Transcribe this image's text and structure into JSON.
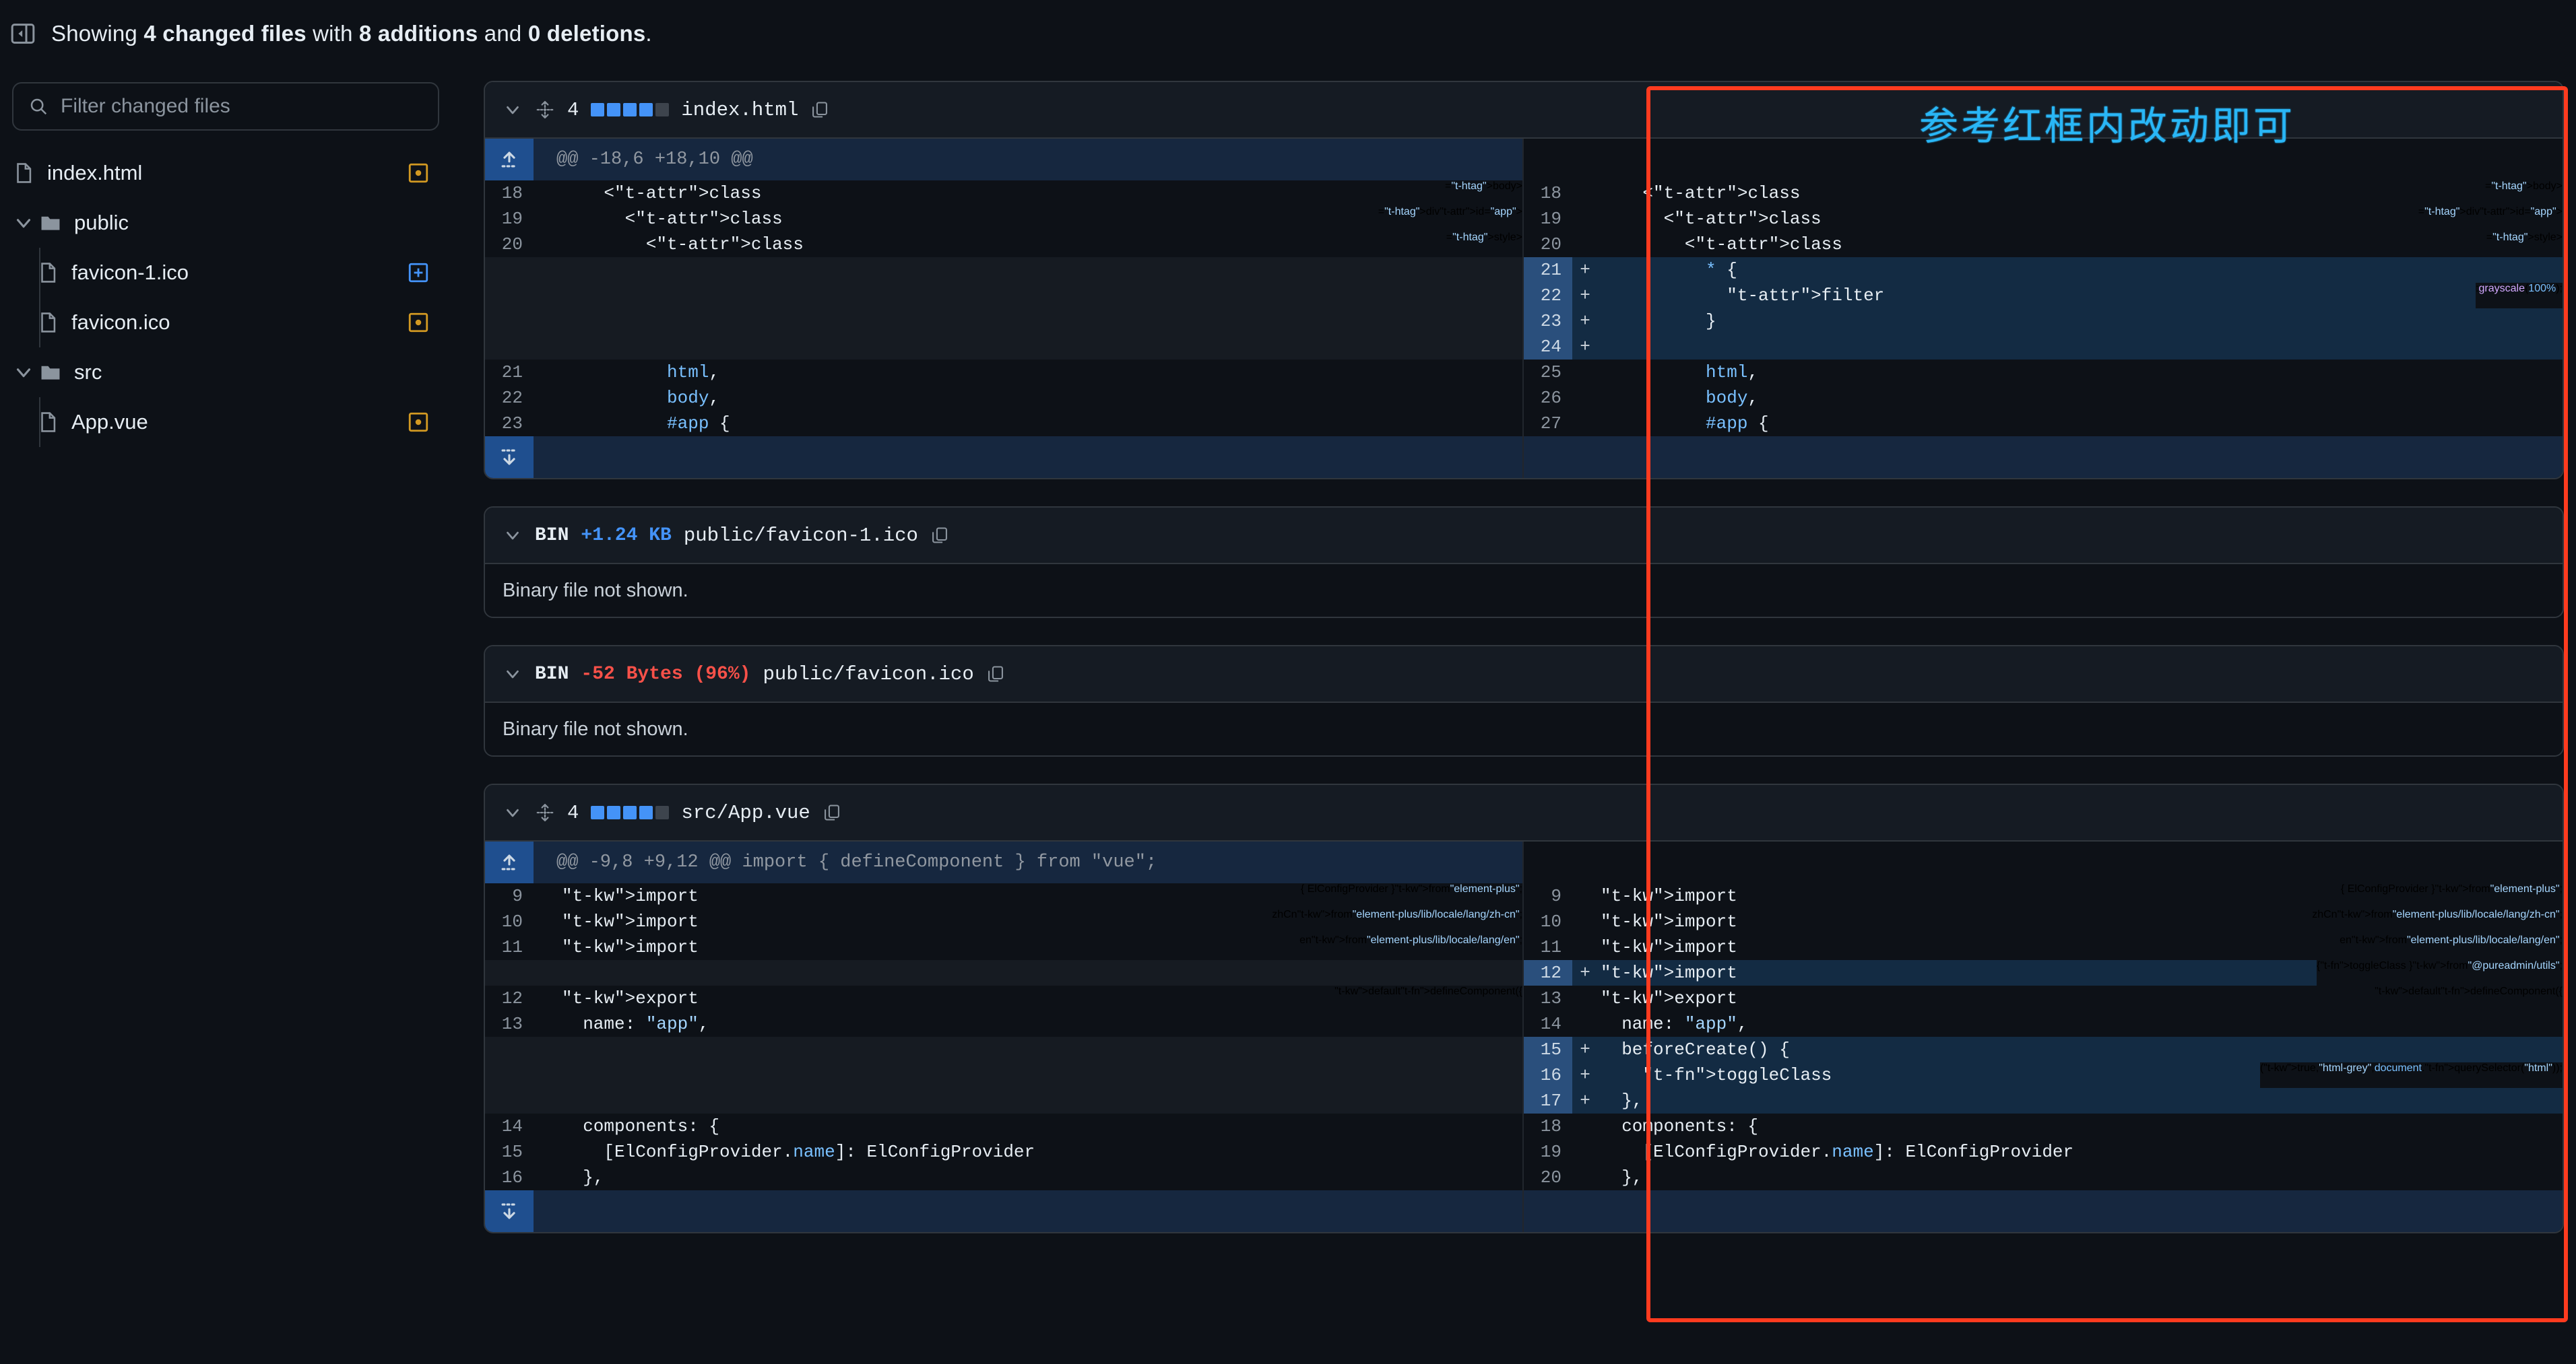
{
  "header": {
    "collapse_icon": "sidebar-collapse-icon",
    "summary_prefix": "Showing ",
    "summary_files": "4 changed files",
    "summary_mid": " with ",
    "summary_additions": "8 additions",
    "summary_and": " and ",
    "summary_deletions": "0 deletions",
    "summary_suffix": "."
  },
  "sidebar": {
    "filter_placeholder": "Filter changed files",
    "filter_value": "",
    "search_icon": "search-icon",
    "tree": [
      {
        "label": "index.html",
        "type": "file",
        "depth": 1,
        "icon": "file-icon",
        "status": "modified",
        "status_icon": "dot-square-icon"
      },
      {
        "label": "public",
        "type": "folder",
        "depth": 1,
        "icon": "folder-icon",
        "expanded": true,
        "status": ""
      },
      {
        "label": "favicon-1.ico",
        "type": "file",
        "depth": 2,
        "icon": "file-icon",
        "status": "added",
        "status_icon": "plus-square-icon"
      },
      {
        "label": "favicon.ico",
        "type": "file",
        "depth": 2,
        "icon": "file-icon",
        "status": "modified",
        "status_icon": "dot-square-icon"
      },
      {
        "label": "src",
        "type": "folder",
        "depth": 1,
        "icon": "folder-icon",
        "expanded": true,
        "status": ""
      },
      {
        "label": "App.vue",
        "type": "file",
        "depth": 2,
        "icon": "file-icon",
        "status": "modified",
        "status_icon": "dot-square-icon"
      }
    ]
  },
  "annotation": {
    "text": "参考红框内改动即可",
    "box_color": "#ff3b1f",
    "text_color": "#29b6f6"
  },
  "files": [
    {
      "kind": "text",
      "changes": "4",
      "stat_squares": [
        "add",
        "add",
        "add",
        "add",
        "neutral"
      ],
      "path": "index.html",
      "copy_icon": "copy-path-icon",
      "chevron_icon": "chevron-down-icon",
      "move_icon": "move-handle-icon",
      "hunk_header": "@@ -18,6 +18,10 @@",
      "expand_up_icon": "expand-up-icon",
      "expand_down_icon": "expand-down-icon",
      "left": [
        {
          "type": "ctx",
          "num": "18",
          "sign": "",
          "code": "    <body>"
        },
        {
          "type": "ctx",
          "num": "19",
          "sign": "",
          "code": "      <div id=\"app\">"
        },
        {
          "type": "ctx",
          "num": "20",
          "sign": "",
          "code": "        <style>"
        },
        {
          "type": "empty",
          "num": "",
          "sign": "",
          "code": ""
        },
        {
          "type": "empty",
          "num": "",
          "sign": "",
          "code": ""
        },
        {
          "type": "empty",
          "num": "",
          "sign": "",
          "code": ""
        },
        {
          "type": "empty",
          "num": "",
          "sign": "",
          "code": ""
        },
        {
          "type": "ctx",
          "num": "21",
          "sign": "",
          "code": "          html,"
        },
        {
          "type": "ctx",
          "num": "22",
          "sign": "",
          "code": "          body,"
        },
        {
          "type": "ctx",
          "num": "23",
          "sign": "",
          "code": "          #app {"
        }
      ],
      "right": [
        {
          "type": "ctx",
          "num": "18",
          "sign": "",
          "code": "    <body>"
        },
        {
          "type": "ctx",
          "num": "19",
          "sign": "",
          "code": "      <div id=\"app\">"
        },
        {
          "type": "ctx",
          "num": "20",
          "sign": "",
          "code": "        <style>"
        },
        {
          "type": "add",
          "num": "21",
          "sign": "+",
          "code": "          * {"
        },
        {
          "type": "add",
          "num": "22",
          "sign": "+",
          "code": "            filter: grayscale(100%);"
        },
        {
          "type": "add",
          "num": "23",
          "sign": "+",
          "code": "          }"
        },
        {
          "type": "add",
          "num": "24",
          "sign": "+",
          "code": ""
        },
        {
          "type": "ctx",
          "num": "25",
          "sign": "",
          "code": "          html,"
        },
        {
          "type": "ctx",
          "num": "26",
          "sign": "",
          "code": "          body,"
        },
        {
          "type": "ctx",
          "num": "27",
          "sign": "",
          "code": "          #app {"
        }
      ]
    },
    {
      "kind": "binary",
      "bin_label": "BIN",
      "size_change": "+1.24 KB",
      "size_change_kind": "add",
      "path": "public/favicon-1.ico",
      "copy_icon": "copy-path-icon",
      "chevron_icon": "chevron-down-icon",
      "body_text": "Binary file not shown."
    },
    {
      "kind": "binary",
      "bin_label": "BIN",
      "size_change": "-52 Bytes (96%)",
      "size_change_kind": "del",
      "path": "public/favicon.ico",
      "copy_icon": "copy-path-icon",
      "chevron_icon": "chevron-down-icon",
      "body_text": "Binary file not shown."
    },
    {
      "kind": "text",
      "changes": "4",
      "stat_squares": [
        "add",
        "add",
        "add",
        "add",
        "neutral"
      ],
      "path": "src/App.vue",
      "copy_icon": "copy-path-icon",
      "chevron_icon": "chevron-down-icon",
      "move_icon": "move-handle-icon",
      "hunk_header": "@@ -9,8 +9,12 @@ import { defineComponent } from \"vue\";",
      "expand_up_icon": "expand-up-icon",
      "expand_down_icon": "expand-down-icon",
      "left": [
        {
          "type": "ctx",
          "num": "9",
          "sign": "",
          "code": "import { ElConfigProvider } from \"element-plus\";"
        },
        {
          "type": "ctx",
          "num": "10",
          "sign": "",
          "code": "import zhCn from \"element-plus/lib/locale/lang/zh-cn\";"
        },
        {
          "type": "ctx",
          "num": "11",
          "sign": "",
          "code": "import en from \"element-plus/lib/locale/lang/en\";"
        },
        {
          "type": "empty",
          "num": "",
          "sign": "",
          "code": ""
        },
        {
          "type": "ctx",
          "num": "12",
          "sign": "",
          "code": "export default defineComponent({"
        },
        {
          "type": "ctx",
          "num": "13",
          "sign": "",
          "code": "  name: \"app\","
        },
        {
          "type": "empty",
          "num": "",
          "sign": "",
          "code": ""
        },
        {
          "type": "empty",
          "num": "",
          "sign": "",
          "code": ""
        },
        {
          "type": "empty",
          "num": "",
          "sign": "",
          "code": ""
        },
        {
          "type": "ctx",
          "num": "14",
          "sign": "",
          "code": "  components: {"
        },
        {
          "type": "ctx",
          "num": "15",
          "sign": "",
          "code": "    [ElConfigProvider.name]: ElConfigProvider"
        },
        {
          "type": "ctx",
          "num": "16",
          "sign": "",
          "code": "  },"
        }
      ],
      "right": [
        {
          "type": "ctx",
          "num": "9",
          "sign": "",
          "code": "import { ElConfigProvider } from \"element-plus\";"
        },
        {
          "type": "ctx",
          "num": "10",
          "sign": "",
          "code": "import zhCn from \"element-plus/lib/locale/lang/zh-cn\";"
        },
        {
          "type": "ctx",
          "num": "11",
          "sign": "",
          "code": "import en from \"element-plus/lib/locale/lang/en\";"
        },
        {
          "type": "add",
          "num": "12",
          "sign": "+",
          "code": "import { toggleClass } from \"@pureadmin/utils\";"
        },
        {
          "type": "ctx",
          "num": "13",
          "sign": "",
          "code": "export default defineComponent({"
        },
        {
          "type": "ctx",
          "num": "14",
          "sign": "",
          "code": "  name: \"app\","
        },
        {
          "type": "add",
          "num": "15",
          "sign": "+",
          "code": "  beforeCreate() {"
        },
        {
          "type": "add",
          "num": "16",
          "sign": "+",
          "code": "    toggleClass(true, \"html-grey\", document.querySelector(\"html\"));"
        },
        {
          "type": "add",
          "num": "17",
          "sign": "+",
          "code": "  },"
        },
        {
          "type": "ctx",
          "num": "18",
          "sign": "",
          "code": "  components: {"
        },
        {
          "type": "ctx",
          "num": "19",
          "sign": "",
          "code": "    [ElConfigProvider.name]: ElConfigProvider"
        },
        {
          "type": "ctx",
          "num": "20",
          "sign": "",
          "code": "  },"
        }
      ]
    }
  ]
}
